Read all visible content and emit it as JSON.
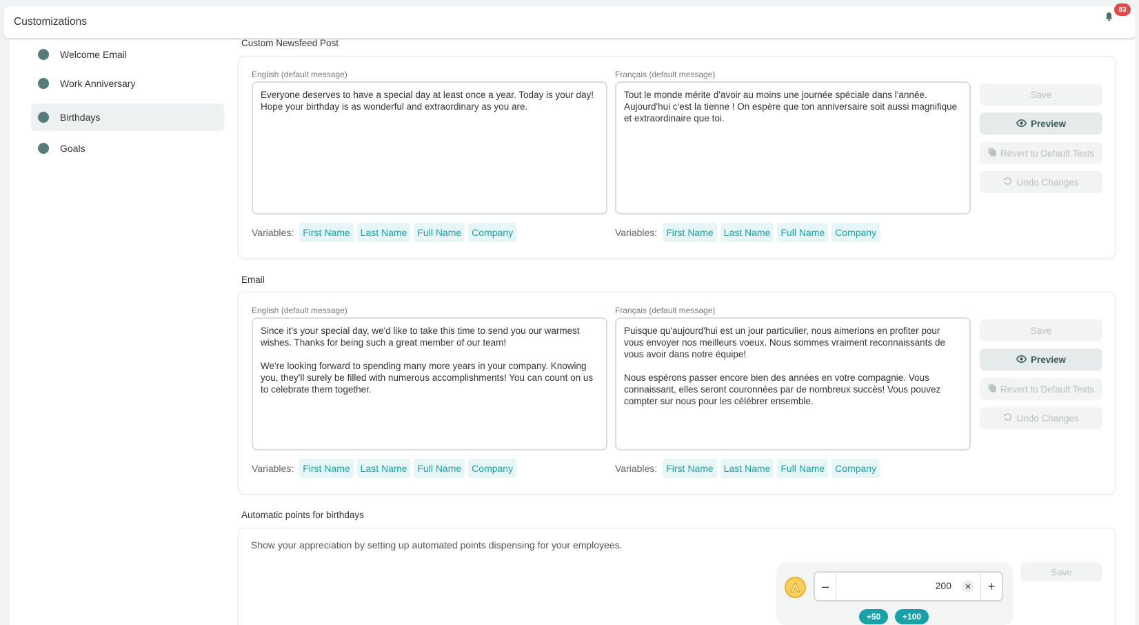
{
  "header": {
    "title": "Customizations",
    "notification_count": "83"
  },
  "sidebar": {
    "items": [
      {
        "label": "Welcome Email"
      },
      {
        "label": "Work Anniversary"
      },
      {
        "label": "Birthdays"
      },
      {
        "label": "Goals"
      }
    ],
    "active": "Birthdays"
  },
  "newsfeed": {
    "title": "Custom Newsfeed Post",
    "english_label": "English (default message)",
    "english_text": "Everyone deserves to have a special day at least once a year. Today is your day! Hope your birthday is as wonderful and extraordinary as you are.",
    "french_label": "Français (default message)",
    "french_text": "Tout le monde mérite d'avoir au moins une journée spéciale dans l'année. Aujourd'hui c'est la tienne ! On espère que ton anniversaire soit aussi magnifique et extraordinaire que toi.",
    "save_label": "Save",
    "preview_label": "Preview",
    "revert_label": "Revert to Default Texts",
    "undo_label": "Undo Changes"
  },
  "email": {
    "title": "Email",
    "english_label": "English (default message)",
    "english_text": "Since it's your special day, we'd like to take this time to send you our warmest wishes. Thanks for being such a great member of our team!\n\nWe're looking forward to spending many more years in your company. Knowing you, they'll surely be filled with numerous accomplishments! You can count on us to celebrate them together.",
    "french_label": "Français (default message)",
    "french_text": "Puisque qu'aujourd'hui est un jour particulier, nous aimerions en profiter pour vous envoyer nos meilleurs voeux. Nous sommes vraiment reconnaissants de vous avoir dans notre équipe!\n\nNous espérons passer encore bien des années en votre compagnie. Vous connaissant, elles seront couronnées par de nombreux succès! Vous pouvez compter sur nous pour les célébrer ensemble.",
    "save_label": "Save",
    "preview_label": "Preview",
    "revert_label": "Revert to Default Texts",
    "undo_label": "Undo Changes"
  },
  "variables": {
    "label": "Variables:",
    "items": [
      "First Name",
      "Last Name",
      "Full Name",
      "Company"
    ]
  },
  "points": {
    "title": "Automatic points for birthdays",
    "description": "Show your appreciation by setting up automated points dispensing for your employees.",
    "value": "200",
    "minus": "–",
    "plus": "+",
    "quick_50": "+50",
    "quick_100": "+100",
    "save_label": "Save"
  },
  "colors": {
    "accent": "#17a2a8",
    "nav_dot": "#557b7b",
    "badge": "#e44b4b"
  },
  "icons": {
    "notifications": "bell-icon",
    "preview": "eye-icon",
    "revert": "copy-icon",
    "undo": "undo-icon",
    "clear": "close-icon",
    "coin": "points-coin-icon"
  }
}
